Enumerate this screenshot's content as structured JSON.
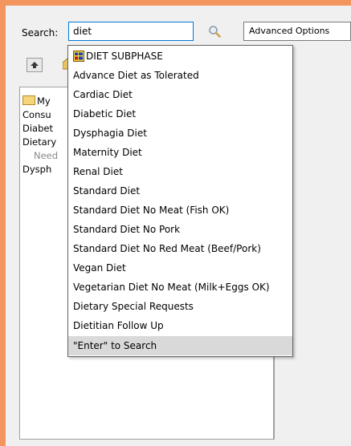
{
  "search": {
    "label": "Search:",
    "value": "diet",
    "advanced_label": "Advanced Options"
  },
  "tree": {
    "items": [
      "My",
      "Consu",
      "Diabet",
      "Dietary",
      "Need",
      "Dysph"
    ]
  },
  "toolbar": {
    "colon_fragment": ":"
  },
  "dropdown": {
    "items": [
      "DIET SUBPHASE",
      "Advance Diet as Tolerated",
      "Cardiac Diet",
      "Diabetic Diet",
      "Dysphagia Diet",
      "Maternity Diet",
      "Renal Diet",
      "Standard Diet",
      "Standard Diet No Meat (Fish OK)",
      "Standard Diet No Pork",
      "Standard Diet No Red Meat (Beef/Pork)",
      "Vegan Diet",
      "Vegetarian Diet No Meat (Milk+Eggs OK)",
      "Dietary Special Requests",
      "Dietitian Follow Up",
      "\"Enter\" to Search"
    ]
  },
  "colors": {
    "frame": "#f2955e",
    "focus_border": "#0078d7",
    "highlight": "#d9d9d9"
  }
}
